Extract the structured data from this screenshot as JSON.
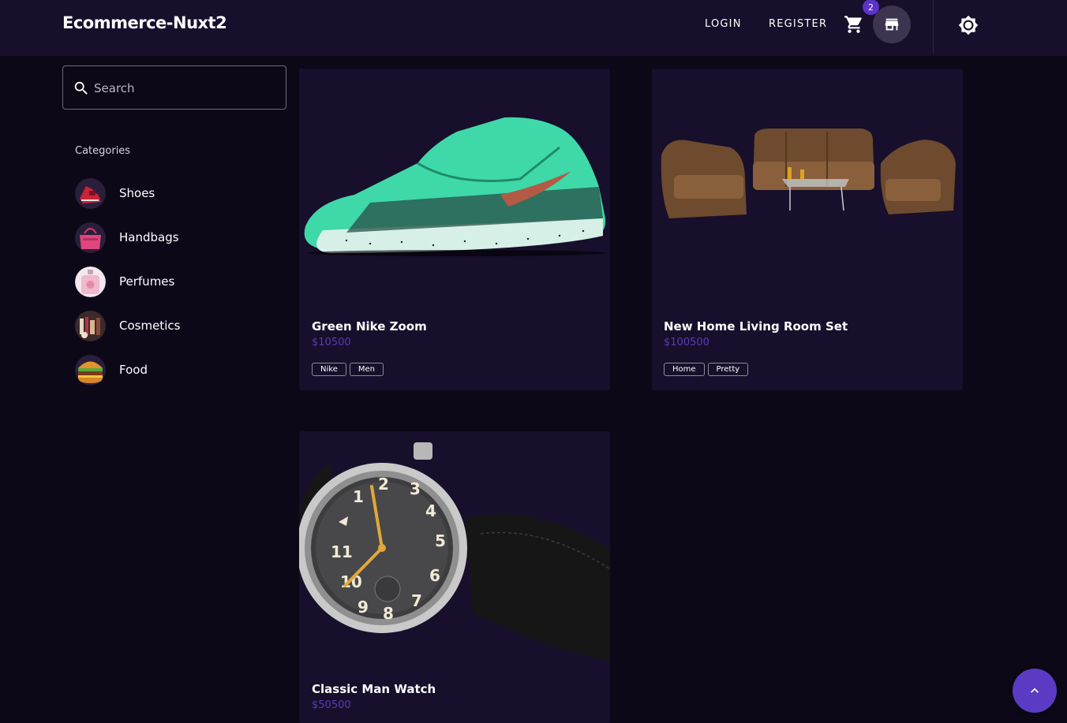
{
  "header": {
    "brand": "Ecommerce-Nuxt2",
    "login_label": "LOGIN",
    "register_label": "REGISTER",
    "cart_count": "2",
    "cart_icon": "cart-icon",
    "store_icon": "store-icon",
    "theme_icon": "brightness-icon"
  },
  "sidebar": {
    "search_placeholder": "Search",
    "categories_title": "Categories",
    "categories": [
      {
        "label": "Shoes"
      },
      {
        "label": "Handbags"
      },
      {
        "label": "Perfumes"
      },
      {
        "label": "Cosmetics"
      },
      {
        "label": "Food"
      }
    ]
  },
  "products": [
    {
      "title": "Green Nike Zoom",
      "price": "$10500",
      "tags": [
        "Nike",
        "Men"
      ]
    },
    {
      "title": "New Home Living Room Set",
      "price": "$100500",
      "tags": [
        "Home",
        "Pretty"
      ]
    },
    {
      "title": "Classic Man Watch",
      "price": "$50500"
    }
  ],
  "colors": {
    "background": "#0c0818",
    "surface": "#170f2b",
    "accent": "#5b3bc4",
    "price": "#5b3bb5"
  }
}
